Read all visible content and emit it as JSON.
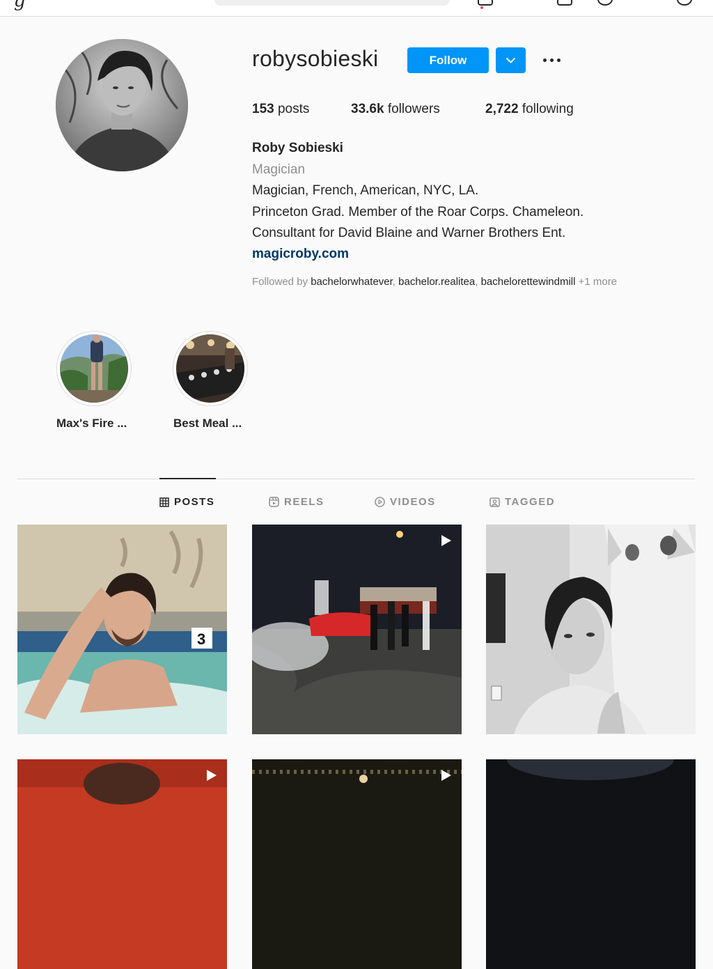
{
  "profile": {
    "username": "robysobieski",
    "follow_label": "Follow",
    "posts_count": "153",
    "posts_label": "posts",
    "followers_count": "33.6k",
    "followers_label": "followers",
    "following_count": "2,722",
    "following_label": "following",
    "full_name": "Roby Sobieski",
    "category": "Magician",
    "bio_lines": [
      "Magician, French, American, NYC, LA.",
      "Princeton Grad. Member of the Roar Corps. Chameleon.",
      "Consultant for David Blaine and Warner Brothers Ent."
    ],
    "website": "magicroby.com",
    "followed_by_prefix": "Followed by",
    "followed_by_users": [
      "bachelorwhatever",
      "bachelor.realitea",
      "bachelorettewindmill"
    ],
    "followed_by_more": "+1 more"
  },
  "highlights": [
    {
      "label": "Max's Fire ..."
    },
    {
      "label": "Best Meal ..."
    }
  ],
  "tabs": [
    {
      "label": "POSTS",
      "icon": "grid-icon",
      "active": true
    },
    {
      "label": "REELS",
      "icon": "reels-icon",
      "active": false
    },
    {
      "label": "VIDEOS",
      "icon": "play-circle-icon",
      "active": false
    },
    {
      "label": "TAGGED",
      "icon": "tagged-icon",
      "active": false
    }
  ],
  "colors": {
    "accent": "#0095f6",
    "link": "#00376b",
    "muted": "#8e8e8e",
    "text": "#262626",
    "background": "#fafafa"
  }
}
